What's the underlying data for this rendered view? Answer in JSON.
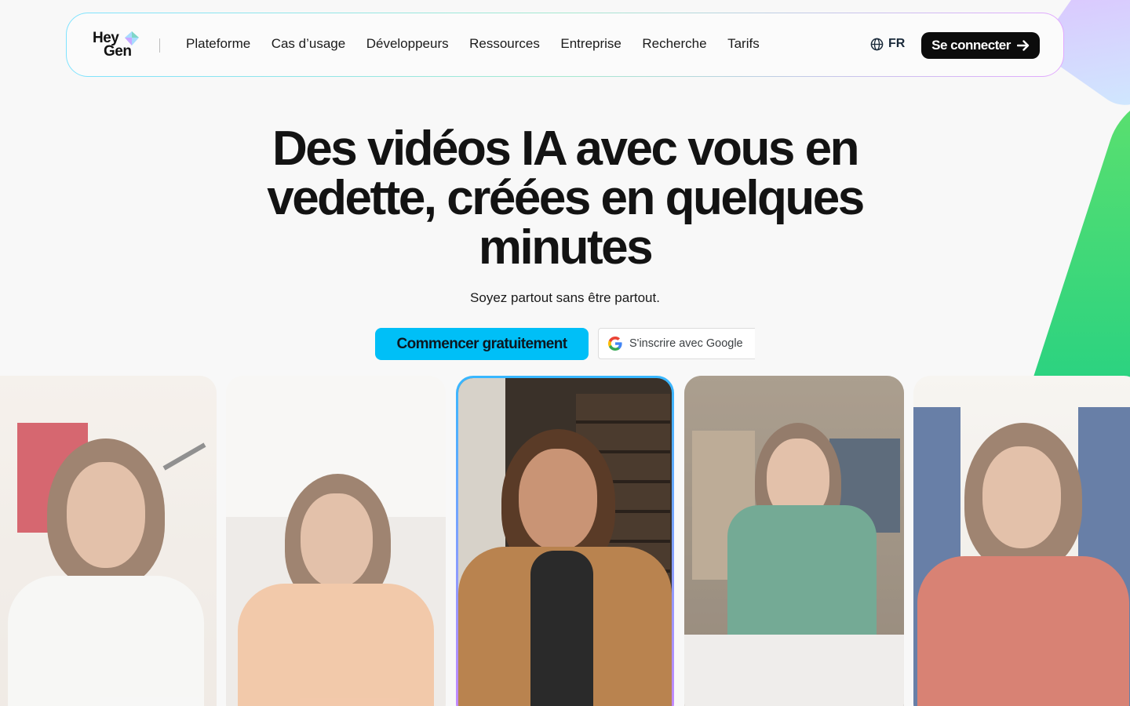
{
  "brand": {
    "line1": "Hey",
    "line2": "Gen"
  },
  "nav": {
    "items": [
      "Plateforme",
      "Cas d’usage",
      "Développeurs",
      "Ressources",
      "Entreprise",
      "Recherche",
      "Tarifs"
    ],
    "language": "FR",
    "login_label": "Se connecter"
  },
  "hero": {
    "title": "Des vidéos IA avec vous en vedette, créées en quelques minutes",
    "subtitle": "Soyez partout sans être partout.",
    "cta_label": "Commencer gratuitement",
    "google_label": "S'inscrire avec Google"
  },
  "icons": {
    "globe": "globe-icon",
    "arrow": "arrow-right-icon",
    "google": "google-g-icon"
  },
  "colors": {
    "cta": "#00bff7",
    "login_bg": "#0c0c0c",
    "accent_green": "#2fd37a",
    "accent_purple": "#c987ff"
  }
}
